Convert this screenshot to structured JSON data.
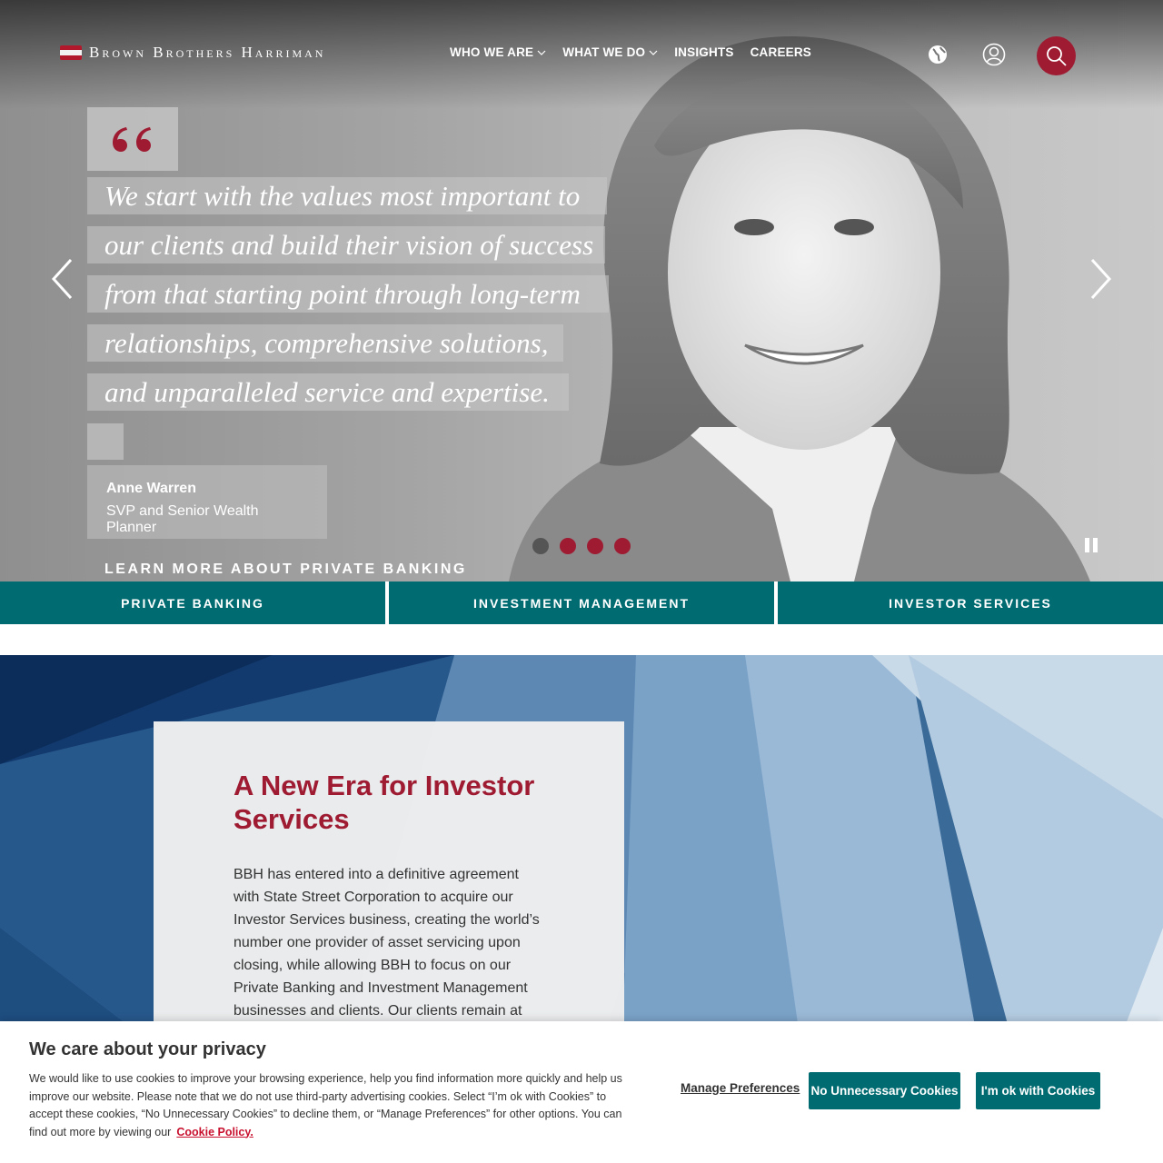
{
  "brand": {
    "name": "Brown Brothers Harriman"
  },
  "nav": {
    "items": [
      {
        "label": "WHO WE ARE",
        "has_dropdown": true
      },
      {
        "label": "WHAT WE DO",
        "has_dropdown": true
      },
      {
        "label": "INSIGHTS",
        "has_dropdown": false
      },
      {
        "label": "CAREERS",
        "has_dropdown": false
      }
    ],
    "icons": [
      "globe-icon",
      "user-icon",
      "search-icon"
    ]
  },
  "hero": {
    "quote_lines": [
      "We start with the values most important to",
      "our clients and build their vision of success",
      "from that starting point through long-term",
      "relationships, comprehensive solutions,",
      "and unparalleled service and expertise."
    ],
    "author_name": "Anne Warren",
    "author_title": "SVP and Senior Wealth Planner",
    "cta": "LEARN MORE ABOUT PRIVATE BANKING",
    "slides_total": 4,
    "active_slide": 1
  },
  "tabs": [
    {
      "label": "PRIVATE BANKING"
    },
    {
      "label": "INVESTMENT MANAGEMENT"
    },
    {
      "label": "INVESTOR SERVICES"
    }
  ],
  "feature": {
    "title": "A New Era for Investor Services",
    "body": "BBH has entered into a definitive agreement with State Street Corporation to acquire our Investor Services business, creating the world’s number one provider of asset servicing upon closing, while allowing BBH to focus on our Private Banking and Investment Management businesses and clients. Our clients remain at the"
  },
  "cookie": {
    "title": "We care about your privacy",
    "text": "We would like to use cookies to improve your browsing experience, help you find information more quickly and help us improve our website. Please note that we do not use third-party advertising cookies. Select “I’m ok with Cookies” to accept these cookies, “No Unnecessary Cookies” to decline them, or “Manage Preferences” for other options. You can find out more by viewing our",
    "link": "Cookie Policy.",
    "manage_label": "Manage Preferences",
    "decline_label": "No Unnecessary Cookies",
    "accept_label": "I'm ok with Cookies"
  },
  "colors": {
    "accent": "#9e1b32",
    "teal": "#006c72"
  }
}
